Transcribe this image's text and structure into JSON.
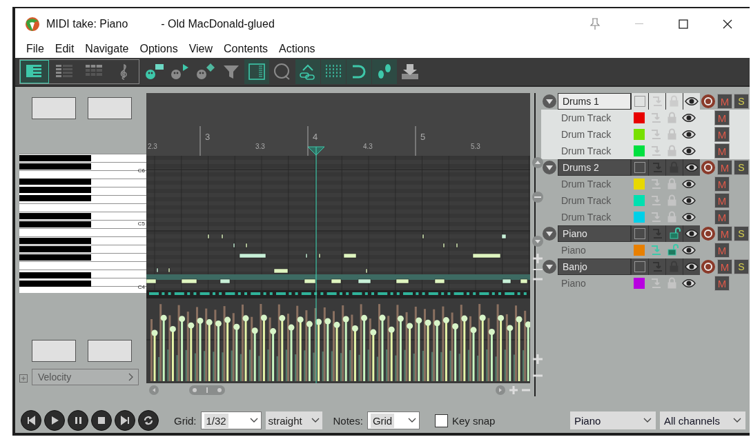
{
  "window": {
    "title": "MIDI take: Piano",
    "subtitle": "- Old MacDonald-glued"
  },
  "menu": [
    "File",
    "Edit",
    "Navigate",
    "Options",
    "View",
    "Contents",
    "Actions"
  ],
  "toolbar": [
    {
      "kind": "piano",
      "selected": true
    },
    {
      "kind": "list",
      "selected": false
    },
    {
      "kind": "drum",
      "selected": false
    },
    {
      "kind": "clef",
      "selected": false
    },
    {
      "kind": "paint-rect",
      "selected": false
    },
    {
      "kind": "paint-tri",
      "selected": false
    },
    {
      "kind": "paint-diamond",
      "selected": false
    },
    {
      "kind": "filter",
      "selected": false
    },
    {
      "kind": "panel",
      "selected": true
    },
    {
      "kind": "loop",
      "selected": false
    },
    {
      "kind": "link",
      "selected": true
    },
    {
      "kind": "grid",
      "selected": true
    },
    {
      "kind": "magnet",
      "selected": true
    },
    {
      "kind": "steps",
      "selected": true
    },
    {
      "kind": "download",
      "selected": false
    }
  ],
  "ruler": [
    {
      "label": "2.3",
      "major": false
    },
    {
      "label": "3",
      "major": true
    },
    {
      "label": "3.3",
      "major": false
    },
    {
      "label": "4",
      "major": true
    },
    {
      "label": "4.3",
      "major": false
    },
    {
      "label": "5",
      "major": true
    },
    {
      "label": "5.3",
      "major": false
    }
  ],
  "keyboard": {
    "labels": [
      "C6",
      "C5",
      "C4"
    ]
  },
  "lane": {
    "label": "Velocity"
  },
  "transport": [
    {
      "kind": "previous"
    },
    {
      "kind": "play"
    },
    {
      "kind": "pause"
    },
    {
      "kind": "stop"
    },
    {
      "kind": "next"
    },
    {
      "kind": "repeat"
    }
  ],
  "footer": {
    "grid_label": "Grid:",
    "grid": "1/32",
    "swing": "straight",
    "notes_label": "Notes:",
    "notes": "Grid",
    "key_snap": {
      "label": "Key snap",
      "checked": false
    },
    "track": "Piano",
    "channel": "All channels"
  },
  "tracks": [
    {
      "name": "Drums 1",
      "selected": true,
      "expanded": true,
      "checked": false,
      "unlocked": false,
      "mute": "M",
      "solo": "S",
      "children": [
        {
          "name": "Drum Track",
          "color": "#e80000",
          "active": false,
          "unlocked": false,
          "mute": "M"
        },
        {
          "name": "Drum Track",
          "color": "#77e000",
          "active": false,
          "unlocked": false,
          "mute": "M"
        },
        {
          "name": "Drum Track",
          "color": "#00e040",
          "active": false,
          "unlocked": false,
          "mute": "M"
        }
      ]
    },
    {
      "name": "Drums 2",
      "selected": false,
      "expanded": true,
      "checked": false,
      "unlocked": false,
      "mute": "M",
      "solo": "S",
      "children": [
        {
          "name": "Drum Track",
          "color": "#e8d800",
          "active": false,
          "unlocked": false,
          "mute": "M"
        },
        {
          "name": "Drum Track",
          "color": "#00e0b0",
          "active": false,
          "unlocked": false,
          "mute": "M"
        },
        {
          "name": "Drum Track",
          "color": "#00d0e8",
          "active": false,
          "unlocked": false,
          "mute": "M"
        }
      ]
    },
    {
      "name": "Piano",
      "selected": false,
      "expanded": true,
      "checked": false,
      "unlocked": true,
      "mute": "M",
      "solo": "S",
      "children": [
        {
          "name": "Piano",
          "color": "#e88000",
          "active": true,
          "unlocked": true,
          "mute": "M"
        }
      ]
    },
    {
      "name": "Banjo",
      "selected": false,
      "expanded": true,
      "checked": false,
      "unlocked": false,
      "mute": "M",
      "solo": "S",
      "children": [
        {
          "name": "Piano",
          "color": "#b800e0",
          "active": false,
          "unlocked": false,
          "mute": "M"
        }
      ]
    }
  ]
}
